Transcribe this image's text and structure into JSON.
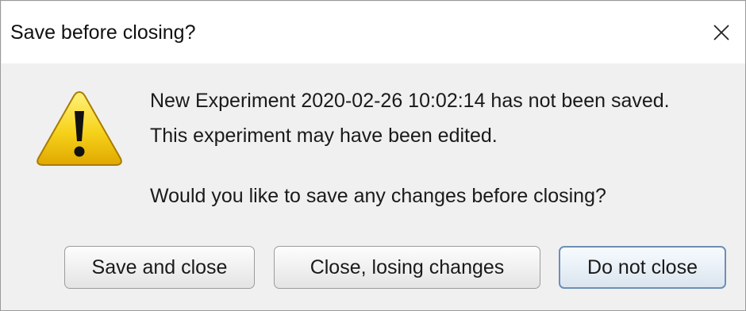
{
  "dialog": {
    "title": "Save before closing?",
    "close_icon": "close-icon",
    "warning_icon": "warning-icon",
    "message_line1": "New Experiment 2020-02-26 10:02:14 has not been saved.",
    "message_line2": "This experiment may have been edited.",
    "message_line3": "Would you like to save any changes before closing?",
    "buttons": {
      "save_and_close": "Save and close",
      "close_losing_changes": "Close, losing changes",
      "do_not_close": "Do not close"
    },
    "default_button": "do_not_close",
    "colors": {
      "background": "#f0f0f0",
      "titlebar": "#ffffff",
      "warning_fill": "#f6d21b",
      "default_button_border": "#6d8fb5"
    }
  }
}
